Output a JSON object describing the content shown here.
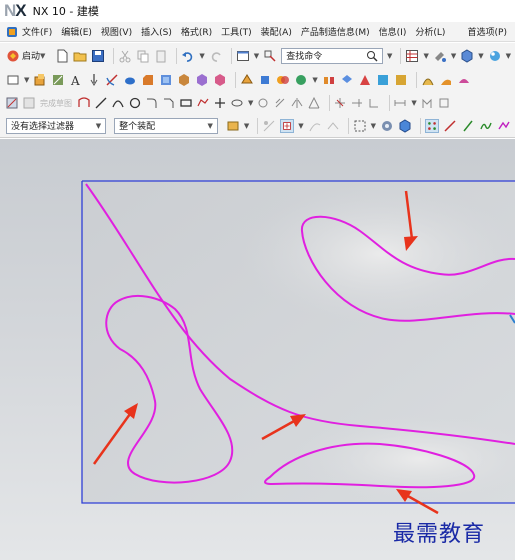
{
  "app": {
    "logo_n": "N",
    "logo_x": "X",
    "title": "NX 10 - 建模"
  },
  "menu": {
    "items": [
      "文件(F)",
      "编辑(E)",
      "视图(V)",
      "插入(S)",
      "格式(R)",
      "工具(T)",
      "装配(A)",
      "产品制造信息(M)",
      "信息(I)",
      "分析(L)"
    ],
    "preferences": "首选项(P)"
  },
  "toolbar": {
    "start_label": "启动",
    "search_placeholder": "查找命令",
    "sketch_faded": "完成草图",
    "filter_value": "没有选择过滤器",
    "scope_value": "整个装配"
  },
  "colors": {
    "curve": "#e020e0",
    "arrow": "#e8331c",
    "sheet_border": "#2f3fd6",
    "watermark": "#1a2aa6"
  },
  "viewport": {
    "watermark": "最需教育"
  }
}
